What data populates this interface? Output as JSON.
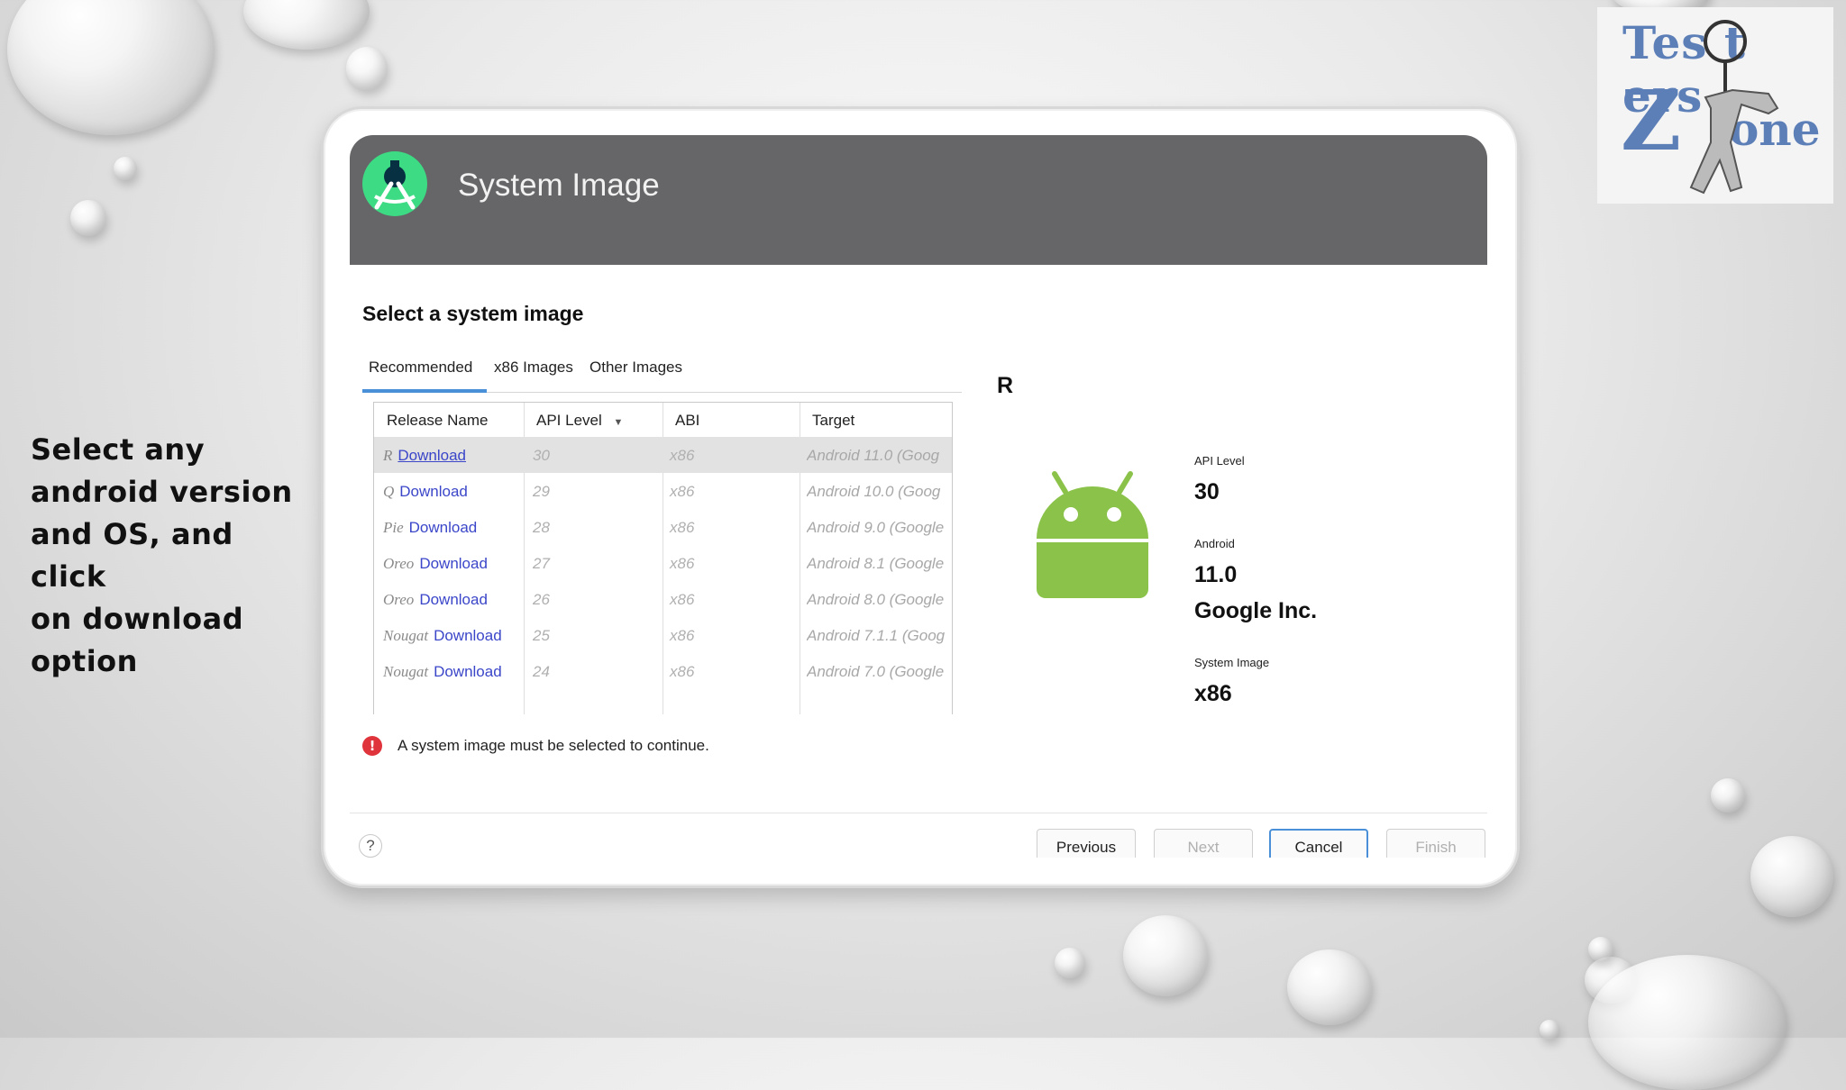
{
  "caption": [
    "Select any",
    "android version",
    "and OS, and click",
    "on download",
    "option"
  ],
  "logo": {
    "line1": "Tes t ers",
    "line2": "Z",
    "line3": "one"
  },
  "dialog": {
    "title": "System Image",
    "section_title": "Select a system image",
    "tabs": [
      "Recommended",
      "x86 Images",
      "Other Images"
    ],
    "active_tab": "Recommended",
    "table": {
      "headers": [
        "Release Name",
        "API Level",
        "ABI",
        "Target"
      ],
      "sort_indicator": "▼",
      "rows": [
        {
          "name": "R",
          "link": "Download",
          "api": "30",
          "abi": "x86",
          "target": "Android 11.0 (Goog",
          "selected": true
        },
        {
          "name": "Q",
          "link": "Download",
          "api": "29",
          "abi": "x86",
          "target": "Android 10.0 (Goog"
        },
        {
          "name": "Pie",
          "link": "Download",
          "api": "28",
          "abi": "x86",
          "target": "Android 9.0 (Google"
        },
        {
          "name": "Oreo",
          "link": "Download",
          "api": "27",
          "abi": "x86",
          "target": "Android 8.1 (Google"
        },
        {
          "name": "Oreo",
          "link": "Download",
          "api": "26",
          "abi": "x86",
          "target": "Android 8.0 (Google"
        },
        {
          "name": "Nougat",
          "link": "Download",
          "api": "25",
          "abi": "x86",
          "target": "Android 7.1.1 (Goog"
        },
        {
          "name": "Nougat",
          "link": "Download",
          "api": "24",
          "abi": "x86",
          "target": "Android 7.0 (Google"
        }
      ]
    },
    "error_icon": "!",
    "error_message": "A system image must be selected to continue.",
    "details": {
      "letter": "R",
      "api_level_label": "API Level",
      "api_level_value": "30",
      "android_label": "Android",
      "android_value": "11.0",
      "vendor": "Google Inc.",
      "system_image_label": "System Image",
      "system_image_value": "x86"
    },
    "help_label": "?",
    "buttons": {
      "previous": "Previous",
      "next": "Next",
      "cancel": "Cancel",
      "finish": "Finish"
    },
    "colors": {
      "header": "#666668",
      "accent": "#4a90d9",
      "link": "#3b46c9",
      "android_green": "#8bc34a",
      "error": "#e0343c"
    }
  }
}
